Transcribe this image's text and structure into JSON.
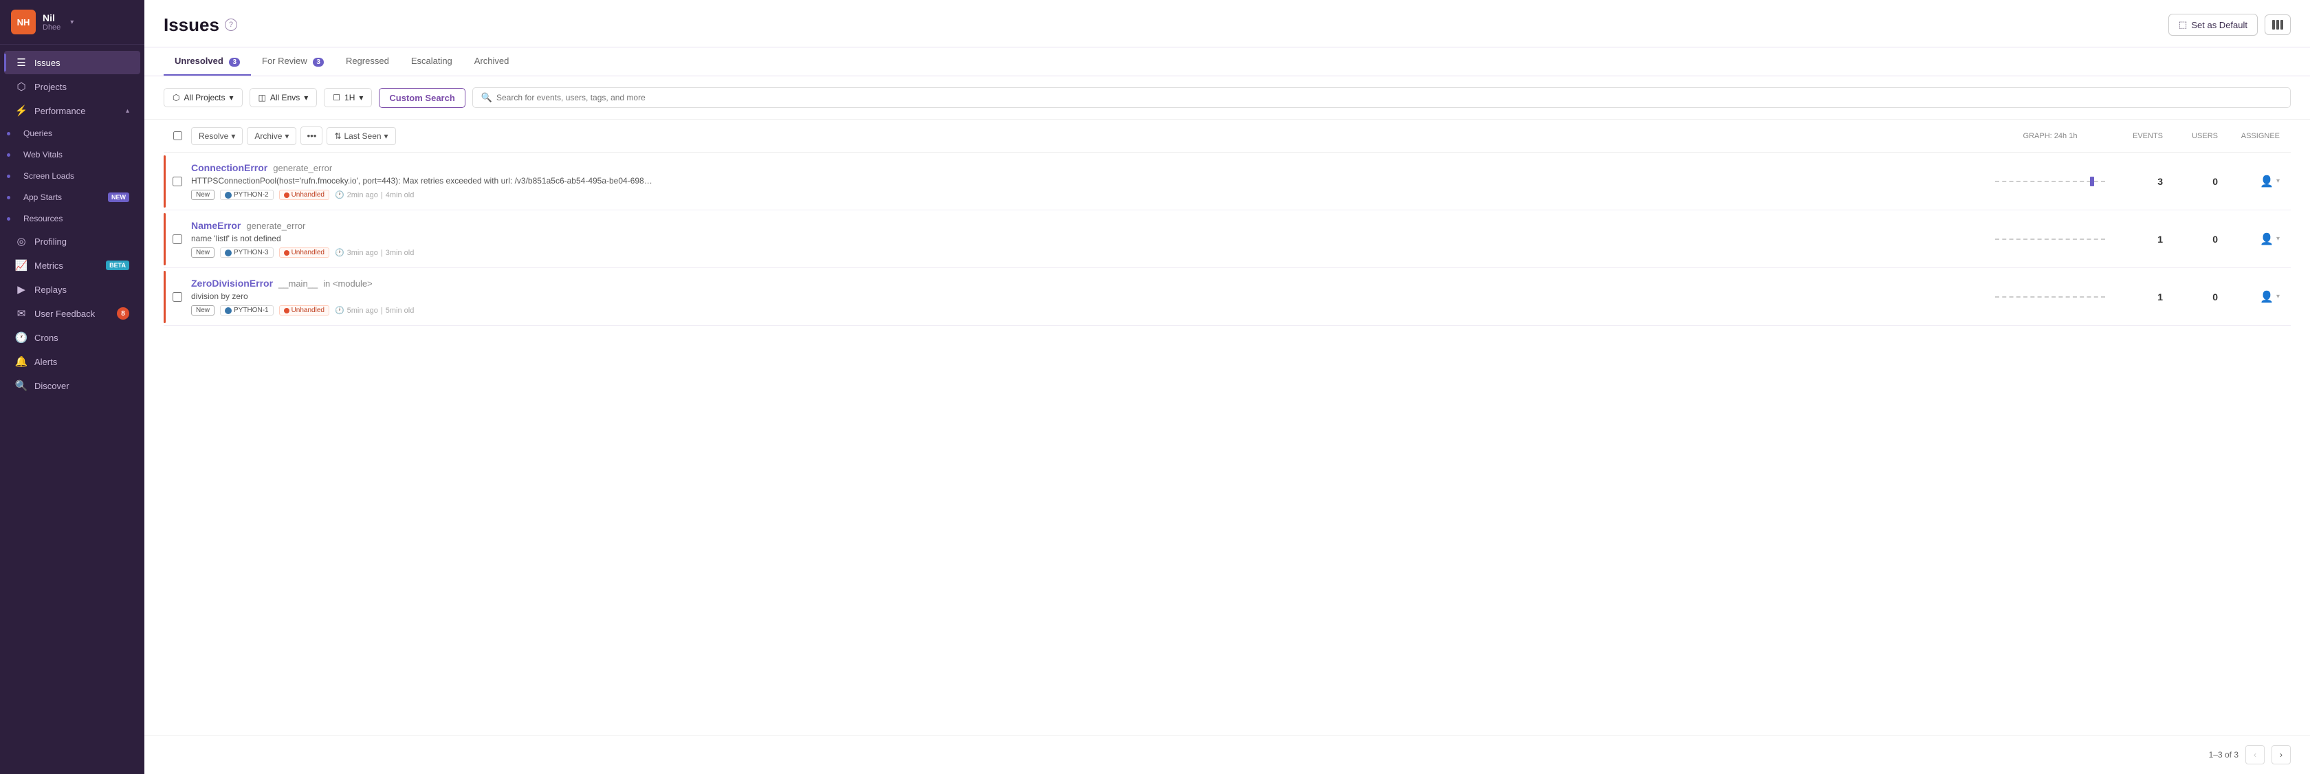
{
  "sidebar": {
    "avatar": "NH",
    "org_name": "Nil",
    "org_sub": "Dhee",
    "nav_items": [
      {
        "id": "issues",
        "label": "Issues",
        "icon": "☰",
        "active": true,
        "badge": null
      },
      {
        "id": "projects",
        "label": "Projects",
        "icon": "◫",
        "active": false,
        "badge": null
      },
      {
        "id": "performance",
        "label": "Performance",
        "icon": "⚡",
        "active": false,
        "badge": null,
        "expandable": true
      },
      {
        "id": "queries",
        "label": "Queries",
        "icon": null,
        "active": false,
        "badge": null,
        "sub": true
      },
      {
        "id": "web-vitals",
        "label": "Web Vitals",
        "icon": null,
        "active": false,
        "badge": null,
        "sub": true
      },
      {
        "id": "screen-loads",
        "label": "Screen Loads",
        "icon": null,
        "active": false,
        "badge": null,
        "sub": true
      },
      {
        "id": "app-starts",
        "label": "App Starts",
        "icon": null,
        "active": false,
        "badge": "new",
        "sub": true
      },
      {
        "id": "resources",
        "label": "Resources",
        "icon": null,
        "active": false,
        "badge": null,
        "sub": true
      },
      {
        "id": "profiling",
        "label": "Profiling",
        "icon": "◎",
        "active": false,
        "badge": null
      },
      {
        "id": "metrics",
        "label": "Metrics",
        "icon": "📈",
        "active": false,
        "badge": "beta"
      },
      {
        "id": "replays",
        "label": "Replays",
        "icon": "▶",
        "active": false,
        "badge": null
      },
      {
        "id": "user-feedback",
        "label": "User Feedback",
        "icon": "✉",
        "active": false,
        "badge_count": "8"
      },
      {
        "id": "crons",
        "label": "Crons",
        "icon": "🕐",
        "active": false,
        "badge": null
      },
      {
        "id": "alerts",
        "label": "Alerts",
        "icon": "🔔",
        "active": false,
        "badge": null
      },
      {
        "id": "discover",
        "label": "Discover",
        "icon": "🔍",
        "active": false,
        "badge": null
      }
    ]
  },
  "header": {
    "title": "Issues",
    "set_default_label": "Set as Default",
    "layout_toggle_label": "Layout Toggle"
  },
  "tabs": [
    {
      "id": "unresolved",
      "label": "Unresolved",
      "count": "3",
      "active": true
    },
    {
      "id": "for-review",
      "label": "For Review",
      "count": "3",
      "active": false
    },
    {
      "id": "regressed",
      "label": "Regressed",
      "count": null,
      "active": false
    },
    {
      "id": "escalating",
      "label": "Escalating",
      "count": null,
      "active": false
    },
    {
      "id": "archived",
      "label": "Archived",
      "count": null,
      "active": false
    }
  ],
  "filters": {
    "all_projects_label": "All Projects",
    "all_envs_label": "All Envs",
    "time_label": "1H",
    "custom_search_label": "Custom Search",
    "search_placeholder": "Search for events, users, tags, and more"
  },
  "table": {
    "columns": {
      "graph_label": "GRAPH:",
      "time_options": "24h  1h",
      "events_label": "EVENTS",
      "users_label": "USERS",
      "assignee_label": "ASSIGNEE"
    },
    "actions": {
      "resolve_label": "Resolve",
      "archive_label": "Archive",
      "sort_label": "Last Seen"
    },
    "issues": [
      {
        "id": 1,
        "error_type": "ConnectionError",
        "error_func": "generate_error",
        "description": "HTTPSConnectionPool(host='rufn.fmoceky.io', port=443): Max retries exceeded with url: /v3/b851a5c6-ab54-495a-be04-698…",
        "tag_new": "New",
        "tag_python": "PYTHON-2",
        "tag_unhandled": "Unhandled",
        "time_ago": "2min ago",
        "age": "4min old",
        "events": "3",
        "users": "0",
        "severity": "error"
      },
      {
        "id": 2,
        "error_type": "NameError",
        "error_func": "generate_error",
        "description": "name 'listf' is not defined",
        "tag_new": "New",
        "tag_python": "PYTHON-3",
        "tag_unhandled": "Unhandled",
        "time_ago": "3min ago",
        "age": "3min old",
        "events": "1",
        "users": "0",
        "severity": "error"
      },
      {
        "id": 3,
        "error_type": "ZeroDivisionError",
        "error_func": "__main__",
        "error_func2": "in <module>",
        "description": "division by zero",
        "tag_new": "New",
        "tag_python": "PYTHON-1",
        "tag_unhandled": "Unhandled",
        "time_ago": "5min ago",
        "age": "5min old",
        "events": "1",
        "users": "0",
        "severity": "error"
      }
    ]
  },
  "pagination": {
    "info": "1–3 of 3"
  }
}
